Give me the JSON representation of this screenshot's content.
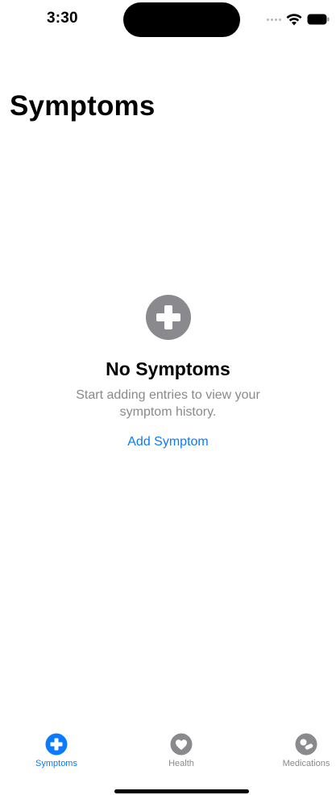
{
  "status_bar": {
    "time": "3:30"
  },
  "page": {
    "title": "Symptoms"
  },
  "empty_state": {
    "icon": "plus-circle-icon",
    "title": "No Symptoms",
    "message": "Start adding entries to view your symptom history.",
    "action_label": "Add Symptom"
  },
  "tab_bar": {
    "tabs": [
      {
        "label": "Symptoms",
        "icon": "plus-circle-icon",
        "active": true
      },
      {
        "label": "Health",
        "icon": "heart-icon",
        "active": false
      },
      {
        "label": "Medications",
        "icon": "pills-icon",
        "active": false
      }
    ]
  },
  "colors": {
    "accent": "#0a7aff",
    "secondary_text": "#8a8a8e",
    "empty_icon": "#8a8a8e",
    "inactive_tab": "#8a8a8e"
  }
}
